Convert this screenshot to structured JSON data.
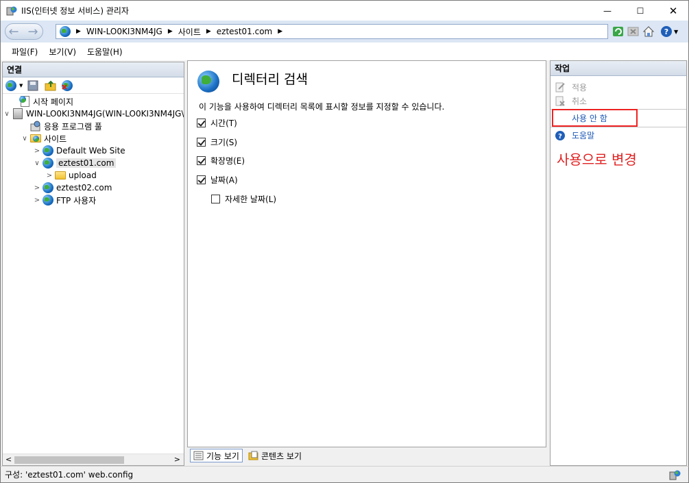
{
  "window": {
    "title": "IIS(인터넷 정보 서비스) 관리자",
    "minimize_glyph": "—",
    "maximize_glyph": "☐",
    "close_glyph": "✕"
  },
  "address": {
    "back_glyph": "←",
    "forward_glyph": "→",
    "crumbs": [
      "WIN-LO0KI3NM4JG",
      "사이트",
      "eztest01.com"
    ],
    "sep_glyph": "▶"
  },
  "menu": {
    "file": "파일(F)",
    "view": "보기(V)",
    "help": "도움말(H)"
  },
  "connections": {
    "header": "연결",
    "tree": [
      {
        "label": "시작 페이지",
        "icon": "start-page-icon"
      },
      {
        "label": "WIN-LO0KI3NM4JG(WIN-LO0KI3NM4JG\\",
        "icon": "server-icon",
        "expander": "∨"
      },
      {
        "label": "응용 프로그램 풀",
        "icon": "app-pool-icon"
      },
      {
        "label": "사이트",
        "icon": "sites-folder-icon",
        "expander": "∨"
      },
      {
        "label": "Default Web Site",
        "icon": "globe-icon",
        "expander": ">"
      },
      {
        "label": "eztest01.com",
        "icon": "globe-icon",
        "expander": "∨",
        "selected": true
      },
      {
        "label": "upload",
        "icon": "folder-icon",
        "expander": ">"
      },
      {
        "label": "eztest02.com",
        "icon": "globe-icon",
        "expander": ">"
      },
      {
        "label": "FTP 사용자",
        "icon": "globe-icon",
        "expander": ">"
      }
    ],
    "scroll_left": "<",
    "scroll_right": ">"
  },
  "feature": {
    "title": "디렉터리 검색",
    "description": "이 기능을 사용하여 디렉터리 목록에 표시할 정보를 지정할 수 있습니다.",
    "options": [
      {
        "label": "시간(T)",
        "checked": true
      },
      {
        "label": "크기(S)",
        "checked": true
      },
      {
        "label": "확장명(E)",
        "checked": true
      },
      {
        "label": "날짜(A)",
        "checked": true
      },
      {
        "label": "자세한 날짜(L)",
        "checked": false
      }
    ],
    "tabs": {
      "features_view": "기능 보기",
      "content_view": "콘텐츠 보기"
    }
  },
  "actions": {
    "header": "작업",
    "apply": "적용",
    "cancel": "취소",
    "disable": "사용 안 함",
    "help": "도움말",
    "annotation": "사용으로 변경",
    "annotation_color": "#e02020"
  },
  "status": {
    "text": "구성: 'eztest01.com' web.config"
  }
}
